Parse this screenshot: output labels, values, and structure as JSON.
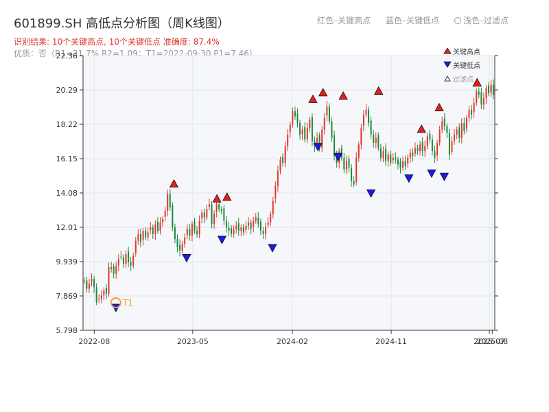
{
  "title": "601899.SH 高低点分析图（周K线图）",
  "result_line": "识别结果: 10个关键高点, 10个关键低点   准确度: 87.4%",
  "opt_line": "优质：否（R1=31.7%  R2=1.09；T1=2022-09-30 P1=7.46）",
  "top_legend": {
    "red": "红色–关键高点",
    "blue": "蓝色–关键低点",
    "light": "浅色–过滤点"
  },
  "legend": {
    "high": "关键高点",
    "low": "关键低点",
    "filtered": "过滤点"
  },
  "colors": {
    "up": "#e0362b",
    "down": "#1a8a3a",
    "high": "#e61e1e",
    "low": "#1a1aee",
    "t1": "#f0a030"
  },
  "chart_data": {
    "type": "candlestick",
    "title": "601899.SH 高低点分析图（周K线图）",
    "y_ticks": [
      "5.798",
      "7.869",
      "9.939",
      "12.01",
      "14.08",
      "16.15",
      "18.22",
      "20.29",
      "22.36"
    ],
    "ylim": [
      5.798,
      22.36
    ],
    "x_ticks": [
      "2022-08",
      "2023-05",
      "2024-02",
      "2024-11",
      "2025-07",
      "2025-08"
    ],
    "xlim": [
      "2022-07-01",
      "2025-08-15"
    ],
    "grid": true,
    "t1_label": "T1",
    "t1": {
      "date": "2022-09-30",
      "price": 7.46
    },
    "close": [
      8.8,
      8.3,
      8.6,
      8.9,
      8.4,
      7.5,
      7.7,
      7.9,
      8.2,
      8.0,
      9.6,
      9.5,
      9.2,
      9.7,
      10.1,
      10.2,
      9.8,
      10.4,
      9.9,
      9.7,
      10.3,
      11.2,
      11.6,
      11.1,
      11.8,
      11.4,
      11.7,
      12.0,
      11.6,
      12.2,
      11.8,
      12.3,
      12.5,
      13.0,
      14.0,
      13.2,
      12.0,
      11.3,
      10.8,
      10.6,
      11.0,
      11.4,
      11.9,
      11.5,
      12.2,
      11.8,
      11.6,
      12.4,
      12.9,
      12.6,
      13.1,
      13.4,
      12.2,
      12.8,
      13.4,
      13.1,
      13.0,
      12.4,
      12.0,
      11.8,
      11.6,
      11.9,
      12.1,
      11.8,
      12.0,
      11.7,
      12.1,
      12.3,
      11.9,
      12.4,
      12.6,
      12.2,
      11.8,
      11.6,
      12.0,
      12.3,
      12.8,
      13.6,
      14.5,
      15.4,
      16.1,
      15.9,
      16.9,
      17.6,
      18.2,
      19.0,
      18.7,
      18.3,
      17.6,
      17.9,
      17.3,
      18.0,
      18.5,
      17.2,
      16.9,
      17.4,
      16.8,
      17.9,
      18.6,
      19.3,
      18.4,
      17.4,
      16.3,
      15.9,
      16.6,
      16.2,
      15.5,
      16.0,
      15.6,
      14.8,
      14.6,
      16.2,
      17.0,
      18.0,
      18.8,
      19.1,
      18.3,
      17.6,
      17.1,
      17.4,
      16.8,
      16.2,
      16.6,
      16.0,
      16.4,
      15.9,
      16.2,
      16.1,
      15.8,
      15.6,
      16.0,
      15.7,
      16.2,
      16.5,
      16.3,
      16.8,
      16.6,
      17.0,
      16.6,
      16.9,
      17.5,
      17.3,
      16.6,
      16.2,
      17.1,
      17.9,
      18.4,
      18.1,
      17.7,
      16.4,
      17.2,
      17.6,
      17.9,
      17.4,
      18.3,
      17.8,
      18.6,
      19.1,
      18.8,
      19.5,
      20.2,
      20.0,
      19.4,
      19.8,
      20.4,
      20.1,
      20.6,
      20.0
    ]
  },
  "pivots": {
    "highs": [
      {
        "date": "2023-03-10",
        "price": 14.3
      },
      {
        "date": "2023-07-07",
        "price": 13.4
      },
      {
        "date": "2023-08-04",
        "price": 13.5
      },
      {
        "date": "2024-03-29",
        "price": 19.4
      },
      {
        "date": "2024-04-26",
        "price": 19.8
      },
      {
        "date": "2024-06-21",
        "price": 19.6
      },
      {
        "date": "2024-09-27",
        "price": 19.9
      },
      {
        "date": "2025-01-24",
        "price": 17.6
      },
      {
        "date": "2025-03-14",
        "price": 18.9
      },
      {
        "date": "2025-06-27",
        "price": 20.4
      }
    ],
    "lows": [
      {
        "date": "2022-09-30",
        "price": 7.5
      },
      {
        "date": "2023-04-14",
        "price": 10.5
      },
      {
        "date": "2023-07-21",
        "price": 11.6
      },
      {
        "date": "2023-12-08",
        "price": 11.1
      },
      {
        "date": "2024-04-12",
        "price": 17.2
      },
      {
        "date": "2024-06-07",
        "price": 16.6
      },
      {
        "date": "2024-09-06",
        "price": 14.4
      },
      {
        "date": "2024-12-20",
        "price": 15.3
      },
      {
        "date": "2025-02-21",
        "price": 15.6
      },
      {
        "date": "2025-03-28",
        "price": 15.4
      }
    ]
  }
}
